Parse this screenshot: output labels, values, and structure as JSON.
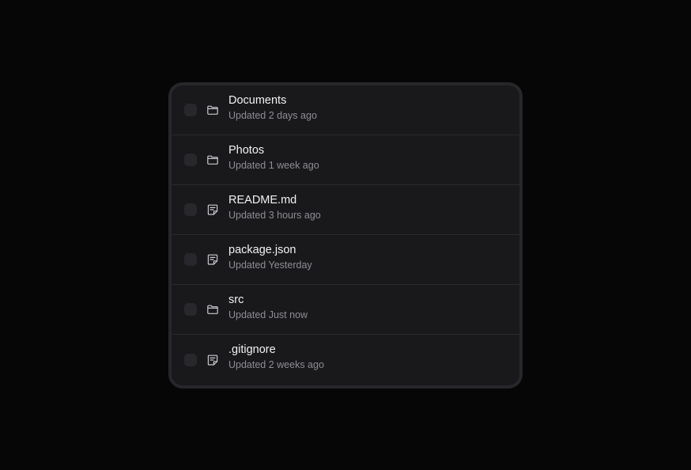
{
  "files": {
    "items": [
      {
        "name": "Documents",
        "icon": "folder-icon",
        "updated": "Updated 2 days ago"
      },
      {
        "name": "Photos",
        "icon": "folder-icon",
        "updated": "Updated 1 week ago"
      },
      {
        "name": "README.md",
        "icon": "file-icon",
        "updated": "Updated 3 hours ago"
      },
      {
        "name": "package.json",
        "icon": "file-icon",
        "updated": "Updated Yesterday"
      },
      {
        "name": "src",
        "icon": "folder-icon",
        "updated": "Updated Just now"
      },
      {
        "name": ".gitignore",
        "icon": "file-icon",
        "updated": "Updated 2 weeks ago"
      }
    ]
  },
  "colors": {
    "background": "#060607",
    "panel": "#19191c",
    "border": "#27272b",
    "text_primary": "#f2f2f4",
    "text_secondary": "#8d8d94"
  }
}
